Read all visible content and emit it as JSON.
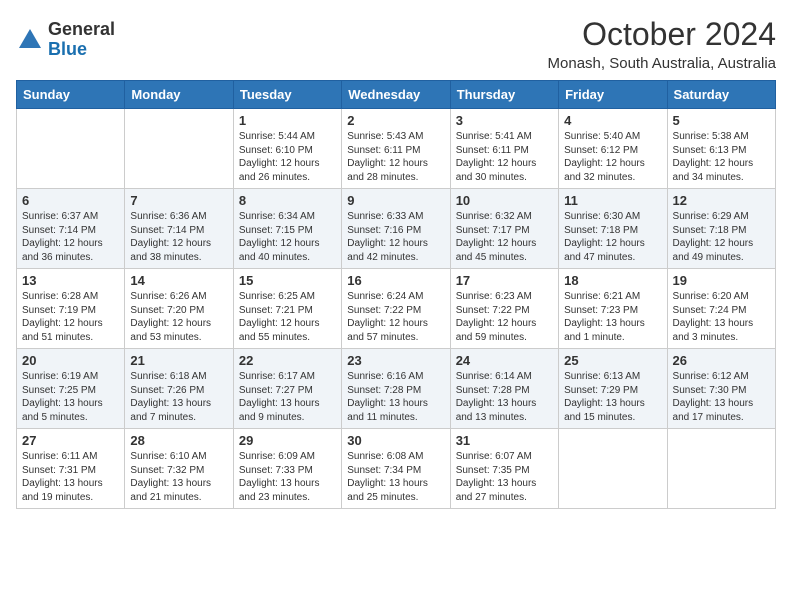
{
  "header": {
    "logo_general": "General",
    "logo_blue": "Blue",
    "month_title": "October 2024",
    "location": "Monash, South Australia, Australia"
  },
  "weekdays": [
    "Sunday",
    "Monday",
    "Tuesday",
    "Wednesday",
    "Thursday",
    "Friday",
    "Saturday"
  ],
  "weeks": [
    [
      {
        "day": "",
        "info": ""
      },
      {
        "day": "",
        "info": ""
      },
      {
        "day": "1",
        "info": "Sunrise: 5:44 AM\nSunset: 6:10 PM\nDaylight: 12 hours\nand 26 minutes."
      },
      {
        "day": "2",
        "info": "Sunrise: 5:43 AM\nSunset: 6:11 PM\nDaylight: 12 hours\nand 28 minutes."
      },
      {
        "day": "3",
        "info": "Sunrise: 5:41 AM\nSunset: 6:11 PM\nDaylight: 12 hours\nand 30 minutes."
      },
      {
        "day": "4",
        "info": "Sunrise: 5:40 AM\nSunset: 6:12 PM\nDaylight: 12 hours\nand 32 minutes."
      },
      {
        "day": "5",
        "info": "Sunrise: 5:38 AM\nSunset: 6:13 PM\nDaylight: 12 hours\nand 34 minutes."
      }
    ],
    [
      {
        "day": "6",
        "info": "Sunrise: 6:37 AM\nSunset: 7:14 PM\nDaylight: 12 hours\nand 36 minutes."
      },
      {
        "day": "7",
        "info": "Sunrise: 6:36 AM\nSunset: 7:14 PM\nDaylight: 12 hours\nand 38 minutes."
      },
      {
        "day": "8",
        "info": "Sunrise: 6:34 AM\nSunset: 7:15 PM\nDaylight: 12 hours\nand 40 minutes."
      },
      {
        "day": "9",
        "info": "Sunrise: 6:33 AM\nSunset: 7:16 PM\nDaylight: 12 hours\nand 42 minutes."
      },
      {
        "day": "10",
        "info": "Sunrise: 6:32 AM\nSunset: 7:17 PM\nDaylight: 12 hours\nand 45 minutes."
      },
      {
        "day": "11",
        "info": "Sunrise: 6:30 AM\nSunset: 7:18 PM\nDaylight: 12 hours\nand 47 minutes."
      },
      {
        "day": "12",
        "info": "Sunrise: 6:29 AM\nSunset: 7:18 PM\nDaylight: 12 hours\nand 49 minutes."
      }
    ],
    [
      {
        "day": "13",
        "info": "Sunrise: 6:28 AM\nSunset: 7:19 PM\nDaylight: 12 hours\nand 51 minutes."
      },
      {
        "day": "14",
        "info": "Sunrise: 6:26 AM\nSunset: 7:20 PM\nDaylight: 12 hours\nand 53 minutes."
      },
      {
        "day": "15",
        "info": "Sunrise: 6:25 AM\nSunset: 7:21 PM\nDaylight: 12 hours\nand 55 minutes."
      },
      {
        "day": "16",
        "info": "Sunrise: 6:24 AM\nSunset: 7:22 PM\nDaylight: 12 hours\nand 57 minutes."
      },
      {
        "day": "17",
        "info": "Sunrise: 6:23 AM\nSunset: 7:22 PM\nDaylight: 12 hours\nand 59 minutes."
      },
      {
        "day": "18",
        "info": "Sunrise: 6:21 AM\nSunset: 7:23 PM\nDaylight: 13 hours\nand 1 minute."
      },
      {
        "day": "19",
        "info": "Sunrise: 6:20 AM\nSunset: 7:24 PM\nDaylight: 13 hours\nand 3 minutes."
      }
    ],
    [
      {
        "day": "20",
        "info": "Sunrise: 6:19 AM\nSunset: 7:25 PM\nDaylight: 13 hours\nand 5 minutes."
      },
      {
        "day": "21",
        "info": "Sunrise: 6:18 AM\nSunset: 7:26 PM\nDaylight: 13 hours\nand 7 minutes."
      },
      {
        "day": "22",
        "info": "Sunrise: 6:17 AM\nSunset: 7:27 PM\nDaylight: 13 hours\nand 9 minutes."
      },
      {
        "day": "23",
        "info": "Sunrise: 6:16 AM\nSunset: 7:28 PM\nDaylight: 13 hours\nand 11 minutes."
      },
      {
        "day": "24",
        "info": "Sunrise: 6:14 AM\nSunset: 7:28 PM\nDaylight: 13 hours\nand 13 minutes."
      },
      {
        "day": "25",
        "info": "Sunrise: 6:13 AM\nSunset: 7:29 PM\nDaylight: 13 hours\nand 15 minutes."
      },
      {
        "day": "26",
        "info": "Sunrise: 6:12 AM\nSunset: 7:30 PM\nDaylight: 13 hours\nand 17 minutes."
      }
    ],
    [
      {
        "day": "27",
        "info": "Sunrise: 6:11 AM\nSunset: 7:31 PM\nDaylight: 13 hours\nand 19 minutes."
      },
      {
        "day": "28",
        "info": "Sunrise: 6:10 AM\nSunset: 7:32 PM\nDaylight: 13 hours\nand 21 minutes."
      },
      {
        "day": "29",
        "info": "Sunrise: 6:09 AM\nSunset: 7:33 PM\nDaylight: 13 hours\nand 23 minutes."
      },
      {
        "day": "30",
        "info": "Sunrise: 6:08 AM\nSunset: 7:34 PM\nDaylight: 13 hours\nand 25 minutes."
      },
      {
        "day": "31",
        "info": "Sunrise: 6:07 AM\nSunset: 7:35 PM\nDaylight: 13 hours\nand 27 minutes."
      },
      {
        "day": "",
        "info": ""
      },
      {
        "day": "",
        "info": ""
      }
    ]
  ]
}
